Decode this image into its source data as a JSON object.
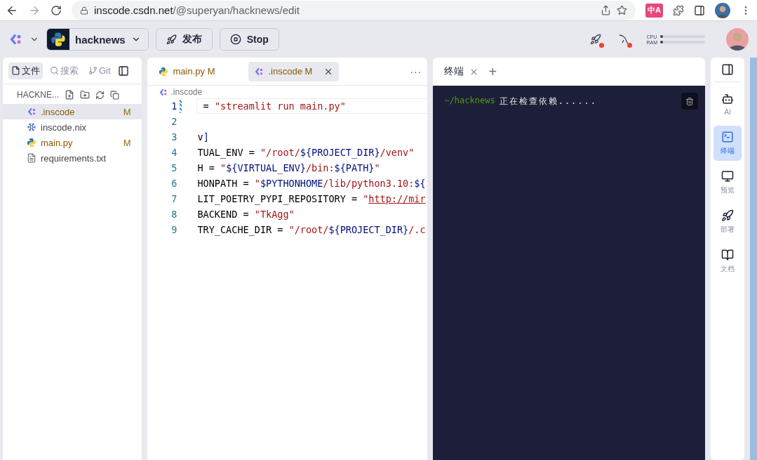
{
  "browser": {
    "url_host": "inscode.csdn.net",
    "url_path": "/@superyan/hacknews/edit",
    "translate_label": "中A"
  },
  "header": {
    "project": "hacknews",
    "publish": "发布",
    "stop": "Stop",
    "status_icons": [
      {
        "kind": "rocket",
        "alert": true
      },
      {
        "kind": "dolphin",
        "alert": true
      }
    ],
    "meters": [
      {
        "label": "CPU",
        "level": 0.06
      },
      {
        "label": "RAM",
        "level": 0.04
      }
    ]
  },
  "sidebar": {
    "tabs": [
      {
        "kind": "files",
        "label": "文件",
        "selected": true
      },
      {
        "kind": "search",
        "label": "搜索",
        "selected": false
      },
      {
        "kind": "git",
        "label": "Git",
        "selected": false
      }
    ],
    "title": "HACKNE...",
    "files": [
      {
        "kind": "inscode",
        "name": ".inscode",
        "badge": "M",
        "modified": true,
        "selected": true
      },
      {
        "kind": "nix",
        "name": "inscode.nix",
        "modified": false,
        "selected": false
      },
      {
        "kind": "python",
        "name": "main.py",
        "badge": "M",
        "modified": true,
        "selected": false
      },
      {
        "kind": "text",
        "name": "requirements.txt",
        "modified": false,
        "selected": false
      }
    ]
  },
  "editor": {
    "tabs": [
      {
        "kind": "python",
        "label": "main.py",
        "badge": "M",
        "selected": false
      },
      {
        "kind": "inscode",
        "label": ".inscode",
        "badge": "M",
        "selected": true,
        "closable": true
      }
    ],
    "more": "···",
    "breadcrumb": ".inscode",
    "lines": [
      {
        "number": "1",
        "current": true,
        "segments": [
          {
            "kind": "plain",
            "text": " = "
          },
          {
            "kind": "str",
            "text": "\"streamlit run main.py\""
          }
        ]
      },
      {
        "number": "2",
        "current": false
      },
      {
        "number": "3",
        "current": false,
        "segments": [
          {
            "kind": "plain",
            "text": "v"
          },
          {
            "kind": "var",
            "text": "]"
          }
        ]
      },
      {
        "number": "4",
        "current": false,
        "segments": [
          {
            "kind": "plain",
            "text": "TUAL_ENV = "
          },
          {
            "kind": "str",
            "text": "\"/root/"
          },
          {
            "kind": "var",
            "text": "${PROJECT_DIR}"
          },
          {
            "kind": "str",
            "text": "/venv\""
          }
        ]
      },
      {
        "number": "5",
        "current": false,
        "segments": [
          {
            "kind": "plain",
            "text": "H = "
          },
          {
            "kind": "str",
            "text": "\""
          },
          {
            "kind": "var",
            "text": "${VIRTUAL_ENV}"
          },
          {
            "kind": "str",
            "text": "/bin:"
          },
          {
            "kind": "var",
            "text": "${PATH}"
          },
          {
            "kind": "str",
            "text": "\""
          }
        ]
      },
      {
        "number": "6",
        "current": false,
        "segments": [
          {
            "kind": "plain",
            "text": "HONPATH = "
          },
          {
            "kind": "str",
            "text": "\""
          },
          {
            "kind": "var",
            "text": "$PYTHONHOME"
          },
          {
            "kind": "str",
            "text": "/lib/python3.10:"
          },
          {
            "kind": "var",
            "text": "${"
          }
        ]
      },
      {
        "number": "7",
        "current": false,
        "segments": [
          {
            "kind": "plain",
            "text": "LIT_POETRY_PYPI_REPOSITORY = "
          },
          {
            "kind": "str",
            "text": "\""
          },
          {
            "kind": "link",
            "text": "http://mir"
          }
        ]
      },
      {
        "number": "8",
        "current": false,
        "segments": [
          {
            "kind": "plain",
            "text": "BACKEND = "
          },
          {
            "kind": "str",
            "text": "\"TkAgg\""
          }
        ]
      },
      {
        "number": "9",
        "current": false,
        "segments": [
          {
            "kind": "plain",
            "text": "TRY_CACHE_DIR = "
          },
          {
            "kind": "str",
            "text": "\"/root/"
          },
          {
            "kind": "var",
            "text": "${PROJECT_DIR}"
          },
          {
            "kind": "str",
            "text": "/.c"
          }
        ]
      }
    ]
  },
  "terminal": {
    "tabs": [
      {
        "label": "终端",
        "selected": true
      }
    ],
    "add": "+",
    "prompt": "~/hacknews",
    "output": "正在检查依赖......"
  },
  "rail": [
    {
      "kind": "robot",
      "label": "AI",
      "selected": false
    },
    {
      "kind": "terminal",
      "label": "终端",
      "selected": true
    },
    {
      "kind": "monitor",
      "label": "预览",
      "selected": false
    },
    {
      "kind": "rocket",
      "label": "部署",
      "selected": false
    },
    {
      "kind": "book",
      "label": "文档",
      "selected": false
    }
  ]
}
